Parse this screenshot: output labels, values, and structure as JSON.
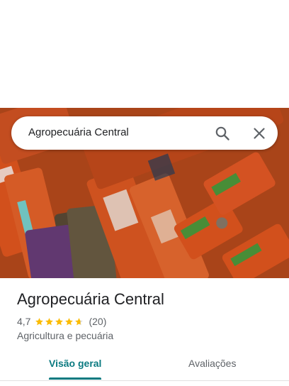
{
  "search": {
    "query": "Agropecuária Central",
    "search_icon": "search-icon",
    "close_icon": "close-icon"
  },
  "hero": {
    "image": "bags of pet food on store shelves",
    "colors": {
      "bag_orange": "#e4571f",
      "bag_dark": "#5b4a36",
      "bag_purple": "#6a3d7a",
      "label_green": "#4f9a3c"
    }
  },
  "place": {
    "name": "Agropecuária Central",
    "rating": "4,7",
    "rating_value": 4.7,
    "stars_max": 5,
    "review_count": "(20)",
    "category": "Agricultura e pecuária"
  },
  "tabs": [
    {
      "label": "Visão geral",
      "active": true
    },
    {
      "label": "Avaliações",
      "active": false
    }
  ],
  "colors": {
    "accent": "#0b7a80",
    "star": "#fbbc04",
    "star_empty": "#dadce0",
    "text_secondary": "#5f6368"
  }
}
